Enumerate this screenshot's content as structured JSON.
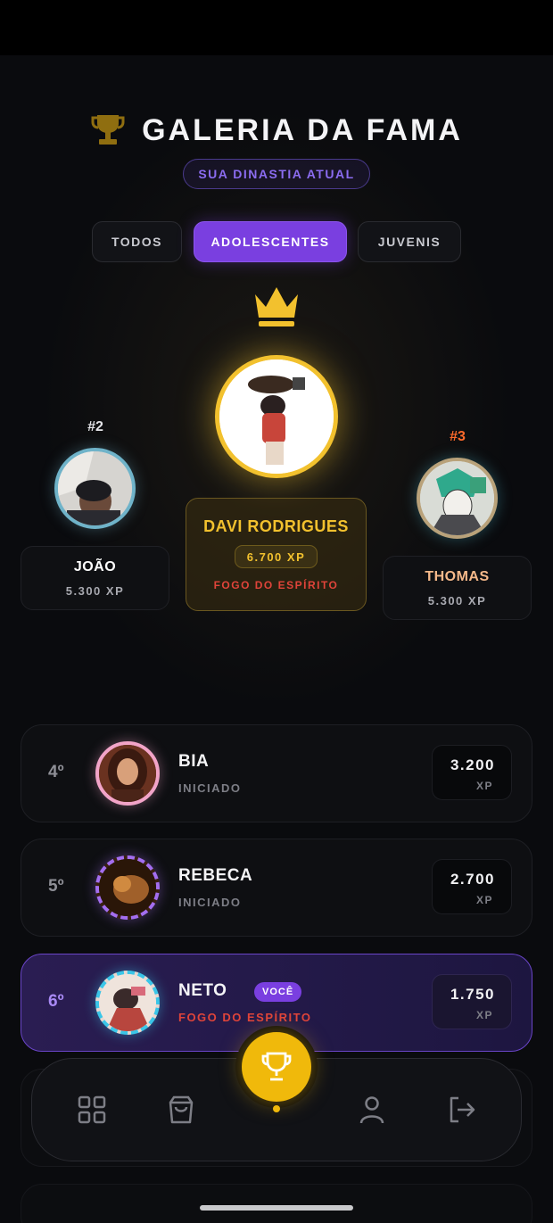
{
  "header": {
    "title": "GALERIA DA FAMA",
    "badge": "SUA DINASTIA ATUAL"
  },
  "tabs": [
    {
      "label": "TODOS",
      "active": false
    },
    {
      "label": "ADOLESCENTES",
      "active": true
    },
    {
      "label": "JUVENIS",
      "active": false
    }
  ],
  "podium": {
    "first": {
      "name": "DAVI RODRIGUES",
      "xp": "6.700 XP",
      "title": "FOGO DO ESPÍRITO"
    },
    "second": {
      "rank": "#2",
      "name": "JOÃO",
      "xp": "5.300 XP"
    },
    "third": {
      "rank": "#3",
      "name": "THOMAS",
      "xp": "5.300 XP"
    }
  },
  "ranking": [
    {
      "pos": "4º",
      "name": "BIA",
      "subtitle": "INICIADO",
      "xp": "3.200",
      "xp_unit": "XP"
    },
    {
      "pos": "5º",
      "name": "REBECA",
      "subtitle": "INICIADO",
      "xp": "2.700",
      "xp_unit": "XP"
    },
    {
      "pos": "6º",
      "name": "NETO",
      "you_label": "VOCÊ",
      "subtitle": "FOGO DO ESPÍRITO",
      "xp": "1.750",
      "xp_unit": "XP"
    }
  ],
  "nav": {
    "items": [
      "grid-icon",
      "bag-icon",
      "trophy-icon",
      "user-icon",
      "logout-icon"
    ],
    "active": "trophy-icon"
  },
  "colors": {
    "accent_purple": "#7a3fe0",
    "gold": "#f0b90b",
    "second_ring": "#6fb3c9",
    "third_accent": "#ff6a2b",
    "fire_red": "#e0443a"
  }
}
